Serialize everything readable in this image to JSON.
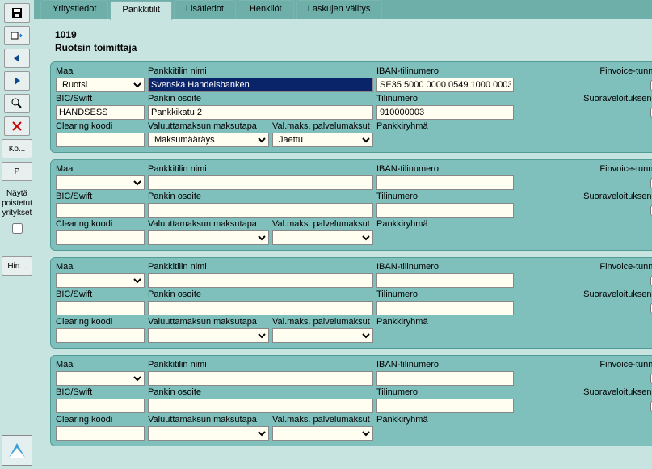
{
  "tabs": {
    "t0": "Yritystiedot",
    "t1": "Pankkitilit",
    "t2": "Lisätiedot",
    "t3": "Henkilöt",
    "t4": "Laskujen välitys"
  },
  "sidebar": {
    "ko": "Ko...",
    "p": "P",
    "show_deleted_label": "Näytä\npoistetut\nyritykset",
    "hin": "Hin..."
  },
  "header": {
    "supplier_id": "1019",
    "supplier_name": "Ruotsin toimittaja"
  },
  "labels": {
    "maa": "Maa",
    "pankkitilin_nimi": "Pankkitilin nimi",
    "iban": "IBAN-tilinumero",
    "finvoice": "Finvoice-tunnus",
    "bic": "BIC/Swift",
    "pankin_osoite": "Pankin osoite",
    "tilinumero": "Tilinumero",
    "suoraveloitus": "Suoraveloituksen tili",
    "clearing": "Clearing koodi",
    "valuutta_maksutapa": "Valuuttamaksun maksutapa",
    "val_palvelumaksut": "Val.maks. palvelumaksut",
    "pankkiryhma": "Pankkiryhmä"
  },
  "banks": [
    {
      "maa": "Ruotsi",
      "pankkitilin_nimi": "Svenska Handelsbanken",
      "iban": "SE35 5000 0000 0549 1000 0003",
      "finvoice": false,
      "bic": "HANDSESS",
      "pankin_osoite": "Pankkikatu 2",
      "tilinumero": "910000003",
      "suoraveloitus": false,
      "clearing": "",
      "valuutta_maksutapa": "Maksumääräys",
      "val_palvelumaksut": "Jaettu",
      "pankkiryhma": ""
    },
    {
      "maa": "",
      "pankkitilin_nimi": "",
      "iban": "",
      "finvoice": false,
      "bic": "",
      "pankin_osoite": "",
      "tilinumero": "",
      "suoraveloitus": false,
      "clearing": "",
      "valuutta_maksutapa": "",
      "val_palvelumaksut": "",
      "pankkiryhma": ""
    },
    {
      "maa": "",
      "pankkitilin_nimi": "",
      "iban": "",
      "finvoice": false,
      "bic": "",
      "pankin_osoite": "",
      "tilinumero": "",
      "suoraveloitus": false,
      "clearing": "",
      "valuutta_maksutapa": "",
      "val_palvelumaksut": "",
      "pankkiryhma": ""
    },
    {
      "maa": "",
      "pankkitilin_nimi": "",
      "iban": "",
      "finvoice": false,
      "bic": "",
      "pankin_osoite": "",
      "tilinumero": "",
      "suoraveloitus": false,
      "clearing": "",
      "valuutta_maksutapa": "",
      "val_palvelumaksut": "",
      "pankkiryhma": ""
    }
  ]
}
